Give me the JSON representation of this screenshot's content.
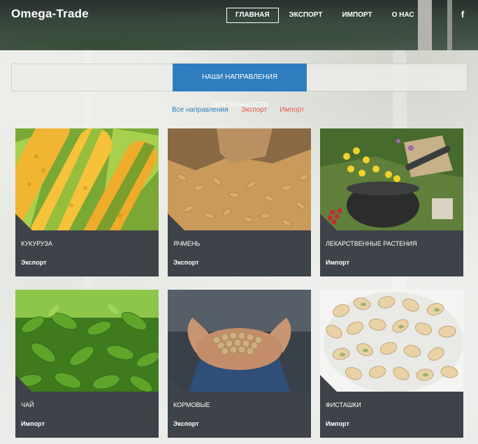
{
  "header": {
    "logo": "Omega-Trade",
    "nav": [
      "ГЛАВНАЯ",
      "ЭКСПОРТ",
      "ИМПОРТ",
      "О НАС"
    ],
    "active_nav": "ГЛАВНАЯ",
    "social_icon": "facebook-icon",
    "social_glyph": "f"
  },
  "section": {
    "title": "НАШИ НАПРАВЛЕНИЯ ДЕЯТЕЛЬНОСТИ"
  },
  "filters": [
    "Все направления",
    "Экспорт",
    "Импорт"
  ],
  "products": [
    {
      "name": "КУКУРУЗА",
      "category": "Экспорт",
      "image": "corn"
    },
    {
      "name": "ЯЧМЕНЬ",
      "category": "Экспорт",
      "image": "barley"
    },
    {
      "name": "ЛЕКАРСТВЕННЫЕ РАСТЕНИЯ",
      "category": "Импорт",
      "image": "herbs"
    },
    {
      "name": "ЧАЙ",
      "category": "Импорт",
      "image": "tea"
    },
    {
      "name": "КОРМОВЫЕ",
      "category": "Экспорт",
      "image": "feed-grain"
    },
    {
      "name": "ФИСТАШКИ",
      "category": "Импорт",
      "image": "pistachios"
    }
  ],
  "colors": {
    "accent_blue": "#2f7dbf",
    "filter_red": "#e45b4e",
    "card_footer": "#3e4349"
  }
}
